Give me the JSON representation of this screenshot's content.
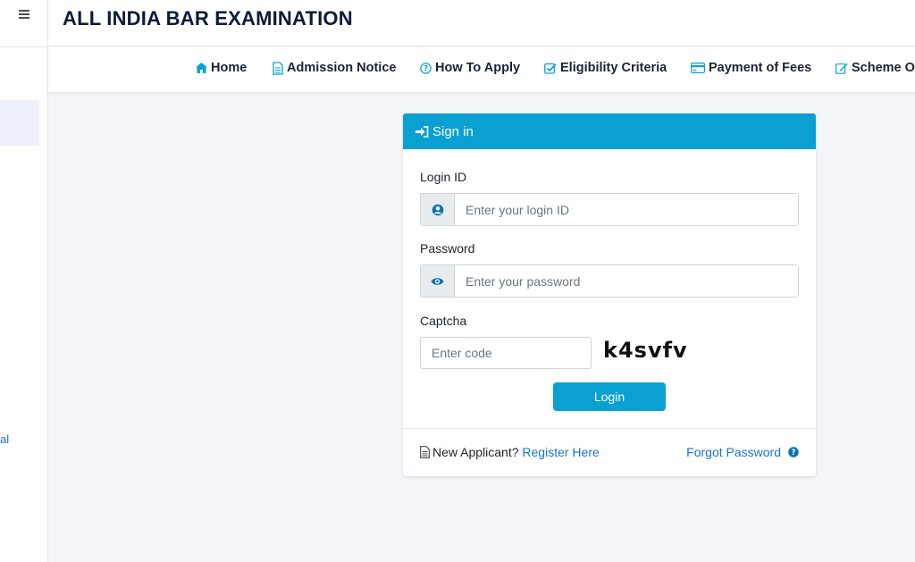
{
  "header": {
    "title": "ALL INDIA BAR EXAMINATION"
  },
  "sidebar": {
    "fragment": "al"
  },
  "nav": {
    "items": [
      {
        "label": "Home",
        "icon": "home-icon"
      },
      {
        "label": "Admission Notice",
        "icon": "document-icon"
      },
      {
        "label": "How To Apply",
        "icon": "question-circle-icon"
      },
      {
        "label": "Eligibility Criteria",
        "icon": "check-square-icon"
      },
      {
        "label": "Payment of Fees",
        "icon": "credit-card-icon"
      },
      {
        "label": "Scheme O",
        "icon": "edit-icon"
      }
    ]
  },
  "signin": {
    "heading": "Sign in",
    "login_label": "Login ID",
    "login_placeholder": "Enter your login ID",
    "password_label": "Password",
    "password_placeholder": "Enter your password",
    "captcha_label": "Captcha",
    "captcha_placeholder": "Enter code",
    "captcha_code": "k4svfv",
    "login_button": "Login",
    "new_applicant": "New Applicant?",
    "register_link": "Register Here",
    "forgot_link": "Forgot Password"
  },
  "colors": {
    "accent": "#0aa0d2",
    "link": "#1a73c8",
    "title": "#0d1a3a"
  }
}
